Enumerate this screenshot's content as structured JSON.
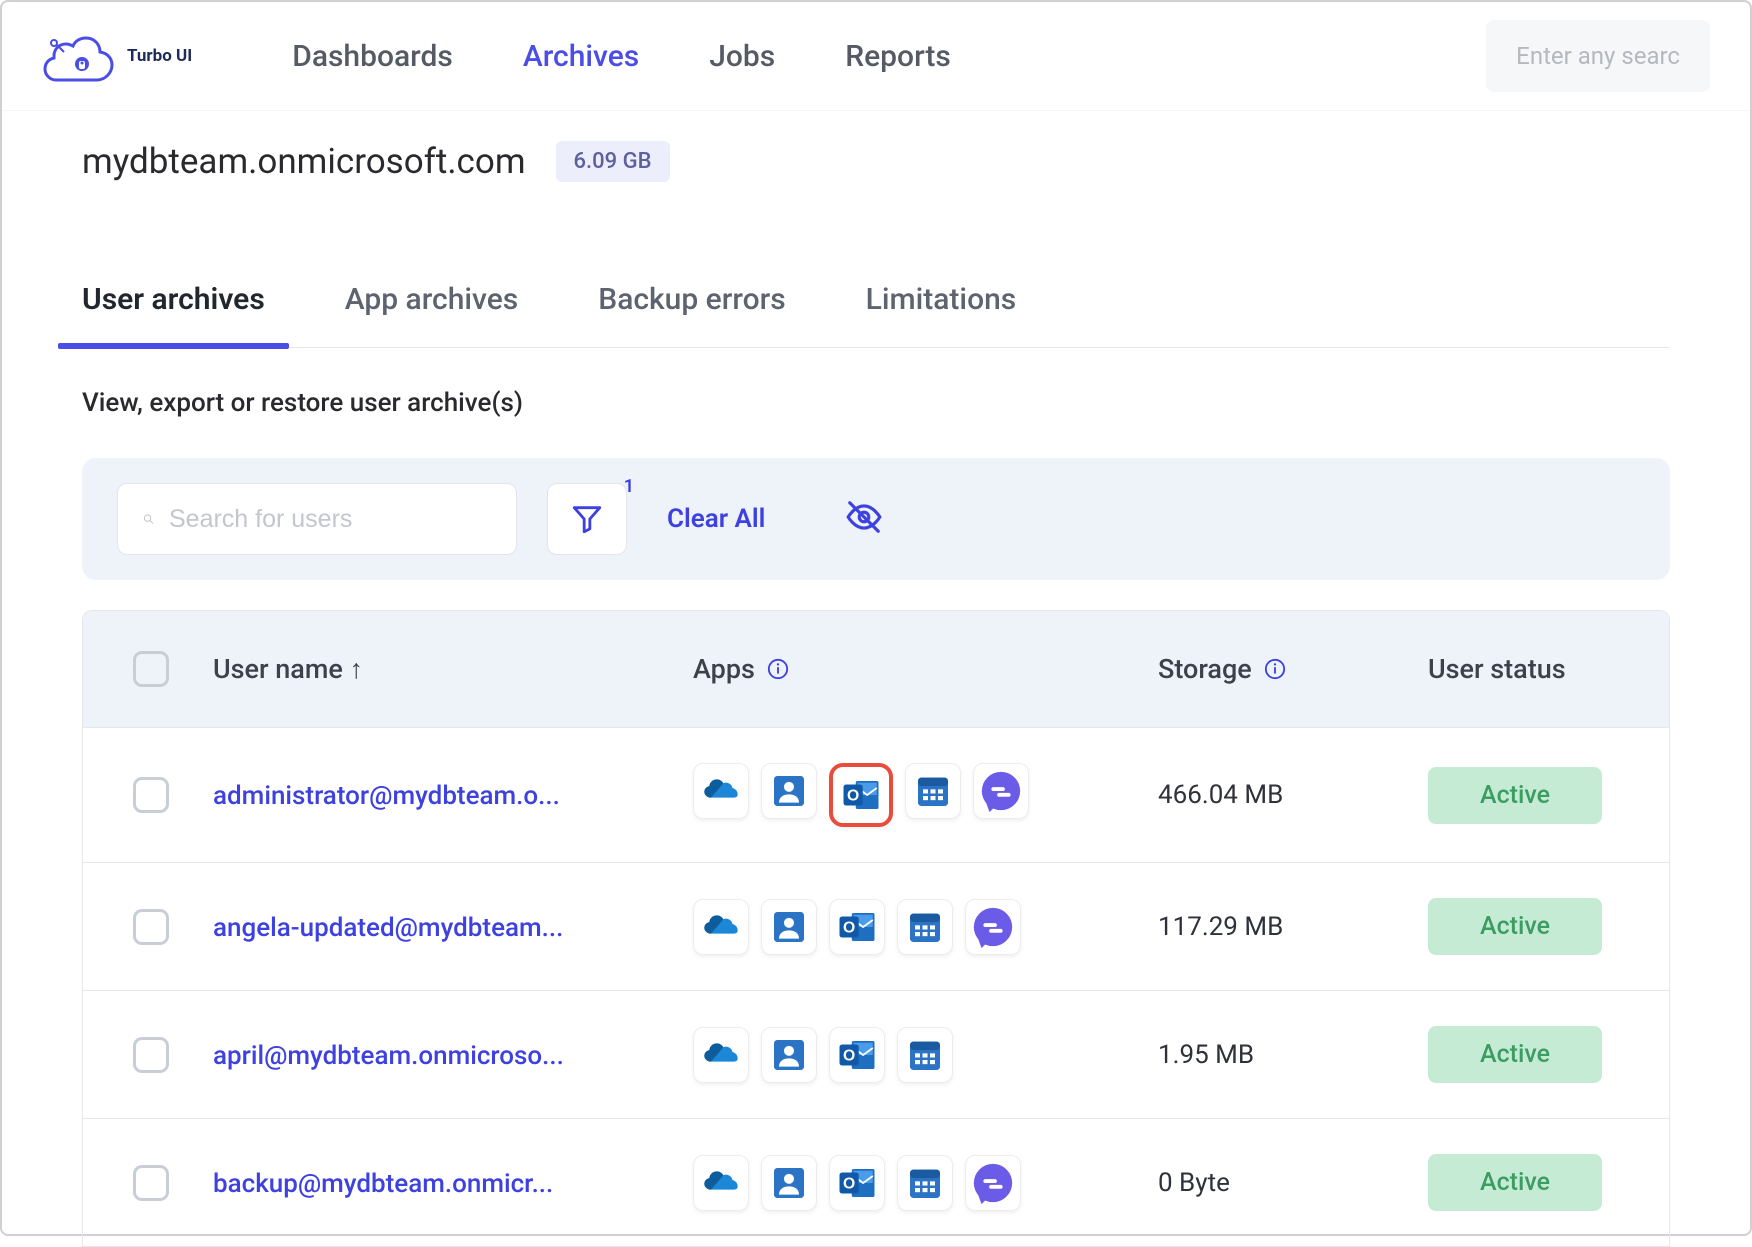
{
  "brand": "Turbo UI",
  "nav": {
    "dashboards": "Dashboards",
    "archives": "Archives",
    "jobs": "Jobs",
    "reports": "Reports"
  },
  "topSearch": {
    "placeholder": "Enter any searc"
  },
  "page": {
    "title": "mydbteam.onmicrosoft.com",
    "sizeBadge": "6.09 GB"
  },
  "tabs": {
    "userArchives": "User archives",
    "appArchives": "App archives",
    "backupErrors": "Backup errors",
    "limitations": "Limitations"
  },
  "subtitle": "View, export or restore user archive(s)",
  "filter": {
    "searchPlaceholder": "Search for users",
    "badgeCount": "1",
    "clearAll": "Clear All"
  },
  "columns": {
    "userName": "User name",
    "apps": "Apps",
    "storage": "Storage",
    "userStatus": "User status"
  },
  "rows": [
    {
      "user": "administrator@mydbteam.o...",
      "apps": [
        "onedrive",
        "contacts",
        "outlook",
        "calendar",
        "teams"
      ],
      "highlight": "outlook",
      "storage": "466.04 MB",
      "status": "Active"
    },
    {
      "user": "angela-updated@mydbteam...",
      "apps": [
        "onedrive",
        "contacts",
        "outlook",
        "calendar",
        "teams"
      ],
      "storage": "117.29 MB",
      "status": "Active"
    },
    {
      "user": "april@mydbteam.onmicroso...",
      "apps": [
        "onedrive",
        "contacts",
        "outlook",
        "calendar"
      ],
      "storage": "1.95 MB",
      "status": "Active"
    },
    {
      "user": "backup@mydbteam.onmicr...",
      "apps": [
        "onedrive",
        "contacts",
        "outlook",
        "calendar",
        "teams"
      ],
      "storage": "0 Byte",
      "status": "Active"
    }
  ]
}
